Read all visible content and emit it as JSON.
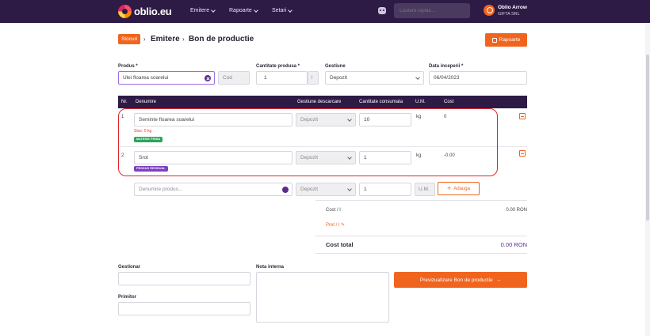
{
  "brand": {
    "name": "oblio.eu"
  },
  "nav": {
    "items": [
      {
        "label": "Emitere"
      },
      {
        "label": "Rapoarte"
      },
      {
        "label": "Setari"
      }
    ],
    "search_placeholder": "Cautare rapida ...",
    "user_name": "Oblio Arrow",
    "user_company": "GIFTA SRL"
  },
  "breadcrumb": {
    "tag": "Stocuri",
    "items": [
      "Emitere",
      "Bon de productie"
    ]
  },
  "header": {
    "rapoarte_label": "Rapoarte"
  },
  "form": {
    "produs_label": "Produs *",
    "produs_value": "Ulei floarea soarelui",
    "cod_placeholder": "Cod",
    "cantitate_label": "Cantitate produsa *",
    "cantitate_value": "1",
    "cantitate_unit": "l",
    "gestiune_label": "Gestiune",
    "gestiune_value": "Depozit",
    "data_label": "Data inceperii *",
    "data_value": "06/04/2023"
  },
  "table": {
    "headers": [
      "Nr.",
      "Denumire",
      "Gestiune descarcare",
      "Cantitate consumata",
      "U.M.",
      "Cost"
    ],
    "rows": [
      {
        "nr": "1",
        "denumire": "Seminte floarea soarelui",
        "stock_note": "Stoc: 0 kg",
        "badge": "MATERIE PRIMA",
        "gestiune": "Depozit",
        "cantitate": "10",
        "um": "kg",
        "cost": "0"
      },
      {
        "nr": "2",
        "denumire": "Srot",
        "badge": "PRODUS REZIDUAL",
        "gestiune": "Depozit",
        "cantitate": "1",
        "um": "kg",
        "cost": "-0.00"
      }
    ],
    "new_row": {
      "denumire_placeholder": "Denumire produs...",
      "gestiune": "Depozit",
      "cantitate": "1",
      "um": "U.M.",
      "add_label": "Adauga"
    }
  },
  "totals": {
    "cost_label": "Cost / l",
    "cost_value": "0.00 RON",
    "pret_label": "Pret / l",
    "total_label": "Cost total",
    "total_value": "0.00 RON"
  },
  "bottom": {
    "gestionar_label": "Gestionar",
    "primitor_label": "Primitor",
    "nota_label": "Nota interna",
    "preview_label": "Previzualizare Bon de productie"
  },
  "colors": {
    "accent": "#f0641e",
    "header": "#2d1a45",
    "highlight": "#e0262a"
  }
}
